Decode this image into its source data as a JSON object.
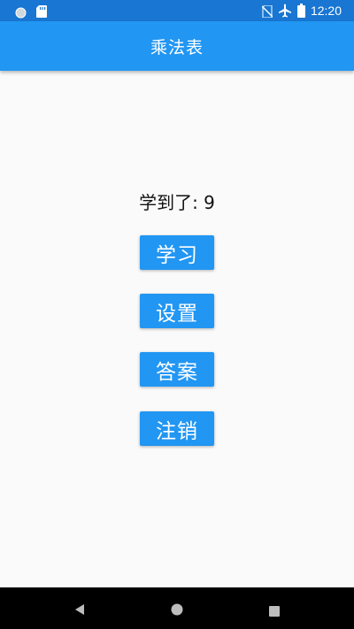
{
  "status_bar": {
    "time": "12:20",
    "icons": [
      "circle-notification-icon",
      "sd-card-icon",
      "no-sim-icon",
      "airplane-icon",
      "battery-icon"
    ]
  },
  "app_bar": {
    "title": "乘法表"
  },
  "main": {
    "learned_text": "学到了: 9",
    "buttons": {
      "study": "学习",
      "settings": "设置",
      "answers": "答案",
      "logout": "注销"
    }
  },
  "nav_bar": {
    "icons": [
      "back-icon",
      "home-icon",
      "recents-icon"
    ]
  },
  "colors": {
    "primary": "#2196f3",
    "primary_dark": "#1976d2",
    "background": "#fafafa",
    "nav_bar": "#000000"
  }
}
